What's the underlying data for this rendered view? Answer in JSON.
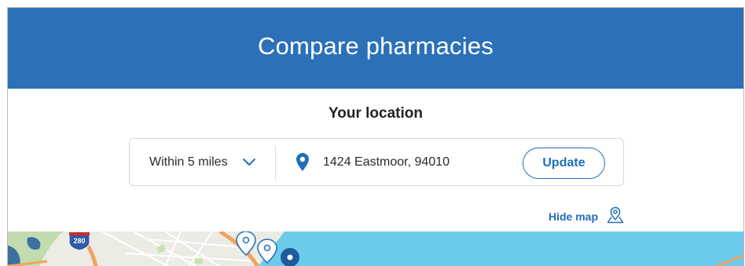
{
  "header": {
    "title": "Compare pharmacies"
  },
  "location": {
    "title": "Your location",
    "radius": {
      "selected": "Within 5 miles"
    },
    "address": {
      "value": "1424 Eastmoor, 94010"
    },
    "update_label": "Update"
  },
  "map": {
    "toggle_label": "Hide map",
    "highway_shield": "280"
  },
  "colors": {
    "header_bg": "#2c71b8",
    "accent": "#1f6fb8",
    "water": "#6ccbea"
  }
}
